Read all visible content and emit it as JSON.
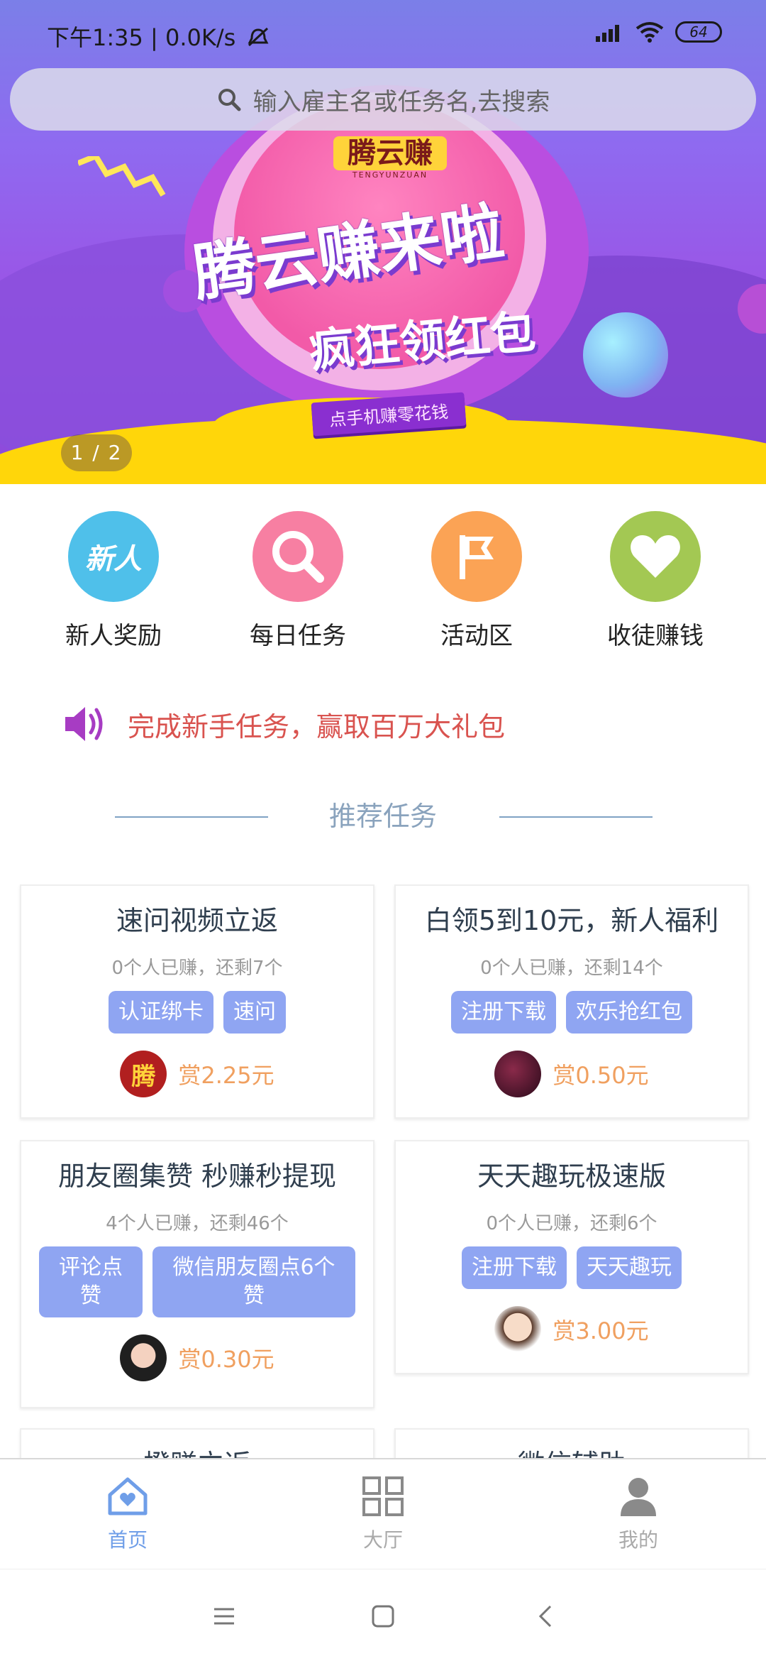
{
  "status_bar": {
    "time": "下午1:35 | 0.0K/s",
    "battery": "64"
  },
  "search": {
    "placeholder": "输入雇主名或任务名,去搜索"
  },
  "banner": {
    "logo_text": "腾云赚",
    "logo_sub": "TENGYUNZUAN",
    "headline": "腾云赚来啦",
    "subline": "疯狂领红包",
    "tagline": "点手机赚零花钱",
    "page_indicator": "1 / 2"
  },
  "categories": [
    {
      "label": "新人奖励",
      "icon": "new-user-icon",
      "icon_text": "新人",
      "color": "#4fc0ea"
    },
    {
      "label": "每日任务",
      "icon": "search-icon",
      "color": "#f77fa2"
    },
    {
      "label": "活动区",
      "icon": "flag-icon",
      "color": "#fba355"
    },
    {
      "label": "收徒赚钱",
      "icon": "heart-icon",
      "color": "#a3c853"
    }
  ],
  "notice": {
    "text": "完成新手任务，赢取百万大礼包",
    "icon": "speaker-icon"
  },
  "section_title": "推荐任务",
  "tasks": [
    {
      "title": "速问视频立返",
      "stats": "0个人已赚，还剩7个",
      "tags": [
        "认证绑卡",
        "速问"
      ],
      "reward": "赏2.25元",
      "avatar_text": "腾"
    },
    {
      "title": "白领5到10元，新人福利",
      "stats": "0个人已赚，还剩14个",
      "tags": [
        "注册下载",
        "欢乐抢红包"
      ],
      "reward": "赏0.50元"
    },
    {
      "title": "朋友圈集赞 秒赚秒提现",
      "stats": "4个人已赚，还剩46个",
      "tags": [
        "评论点赞",
        "微信朋友圈点6个赞"
      ],
      "reward": "赏0.30元"
    },
    {
      "title": "天天趣玩极速版",
      "stats": "0个人已赚，还剩6个",
      "tags": [
        "注册下载",
        "天天趣玩"
      ],
      "reward": "赏3.00元"
    },
    {
      "title": "橙赚立返"
    },
    {
      "title": "微信辅助"
    }
  ],
  "bottom_nav": [
    {
      "label": "首页",
      "icon": "home-icon",
      "active": true
    },
    {
      "label": "大厅",
      "icon": "grid-icon",
      "active": false
    },
    {
      "label": "我的",
      "icon": "profile-icon",
      "active": false
    }
  ],
  "colors": {
    "accent": "#6f9ee8",
    "reward": "#f0a060",
    "tag": "#8fa5f2",
    "notice": "#d9534f"
  }
}
